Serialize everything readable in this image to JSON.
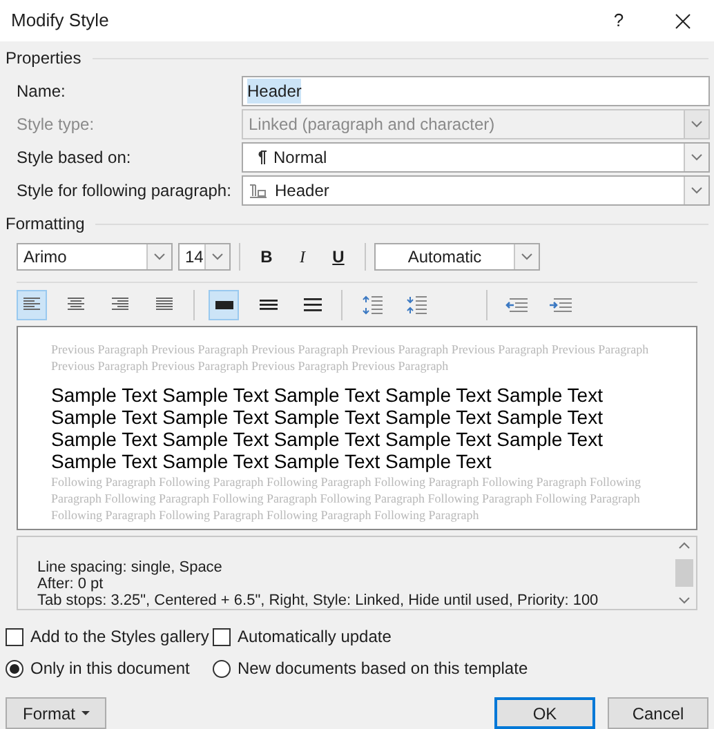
{
  "window": {
    "title": "Modify Style",
    "help": "?"
  },
  "properties": {
    "heading": "Properties",
    "fields": [
      {
        "label": "Name:",
        "kind": "text",
        "value": "Header",
        "disabled": false
      },
      {
        "label": "Style type:",
        "kind": "dropdown",
        "value": "Linked (paragraph and character)",
        "disabled": true
      },
      {
        "label": "Style based on:",
        "kind": "paragraph_style",
        "value": "Normal",
        "disabled": false
      },
      {
        "label": "Style for following paragraph:",
        "kind": "linked_style",
        "value": "Header",
        "disabled": false
      }
    ]
  },
  "formatting": {
    "heading": "Formatting",
    "font": "Arimo",
    "size": "14",
    "styles": [
      {
        "label": "B",
        "kind": "bold",
        "selected": false
      },
      {
        "label": "I",
        "kind": "italic",
        "selected": false
      },
      {
        "label": "U",
        "kind": "underline",
        "selected": false
      }
    ],
    "font_color_choice": "Automatic",
    "alignment": [
      {
        "kind": "left",
        "selected": true
      },
      {
        "kind": "center",
        "selected": false
      },
      {
        "kind": "right",
        "selected": false
      },
      {
        "kind": "justify",
        "selected": false
      }
    ],
    "spacing": [
      {
        "kind": "single",
        "selected": true
      },
      {
        "kind": "onehalf",
        "selected": false
      },
      {
        "kind": "double",
        "selected": false
      }
    ],
    "paragraph_spacing": [
      {
        "kind": "increase"
      },
      {
        "kind": "decrease"
      }
    ],
    "indent": [
      {
        "kind": "decrease"
      },
      {
        "kind": "increase"
      }
    ]
  },
  "preview": {
    "previous": "Previous Paragraph Previous Paragraph Previous Paragraph Previous Paragraph Previous Paragraph Previous Paragraph Previous Paragraph Previous Paragraph Previous Paragraph Previous Paragraph",
    "sample": "Sample Text Sample Text Sample Text Sample Text Sample Text Sample Text Sample Text Sample Text Sample Text Sample Text Sample Text Sample Text Sample Text Sample Text Sample Text Sample Text Sample Text Sample Text Sample Text",
    "following": "Following Paragraph Following Paragraph Following Paragraph Following Paragraph Following Paragraph Following Paragraph Following Paragraph Following Paragraph Following Paragraph Following Paragraph Following Paragraph Following Paragraph Following Paragraph Following Paragraph Following Paragraph"
  },
  "description": [
    "Line spacing:  single, Space",
    "After:  0 pt",
    "Tab stops:  3.25\", Centered +  6.5\", Right, Style: Linked, Hide until used, Priority: 100"
  ],
  "options": [
    {
      "label": "Add to the Styles gallery",
      "kind": "checkbox",
      "checked": false
    },
    {
      "label": "Automatically update",
      "kind": "checkbox",
      "checked": false
    },
    {
      "label": "Only in this document",
      "kind": "radio",
      "selected": true
    },
    {
      "label": "New documents based on this template",
      "kind": "radio",
      "selected": false
    }
  ],
  "buttons": [
    {
      "label": "Format",
      "kind": "menu",
      "default": false
    },
    {
      "label": "OK",
      "kind": "plain",
      "default": true
    },
    {
      "label": "Cancel",
      "kind": "plain",
      "default": false
    }
  ]
}
